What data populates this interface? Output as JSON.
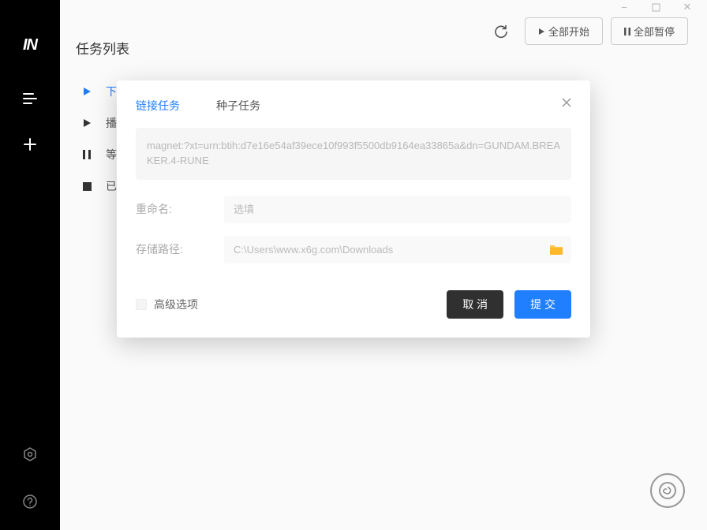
{
  "titlebar": {
    "minimize": "−",
    "maximize": "▢",
    "close": "✕"
  },
  "sidebar": {
    "logo": "IN"
  },
  "header": {
    "title": "任务列表",
    "start_all": "全部开始",
    "pause_all": "全部暂停"
  },
  "filters": {
    "downloading": "下",
    "playable": "播",
    "waiting": "等",
    "done": "已"
  },
  "dialog": {
    "tab_link": "链接任务",
    "tab_seed": "种子任务",
    "url": "magnet:?xt=urn:btih:d7e16e54af39ece10f993f5500db9164ea33865a&dn=GUNDAM.BREAKER.4-RUNE",
    "rename_label": "重命名:",
    "rename_placeholder": "选填",
    "path_label": "存储路径:",
    "path_value": "C:\\Users\\www.x6g.com\\Downloads",
    "advanced": "高级选项",
    "cancel": "取 消",
    "submit": "提 交"
  }
}
